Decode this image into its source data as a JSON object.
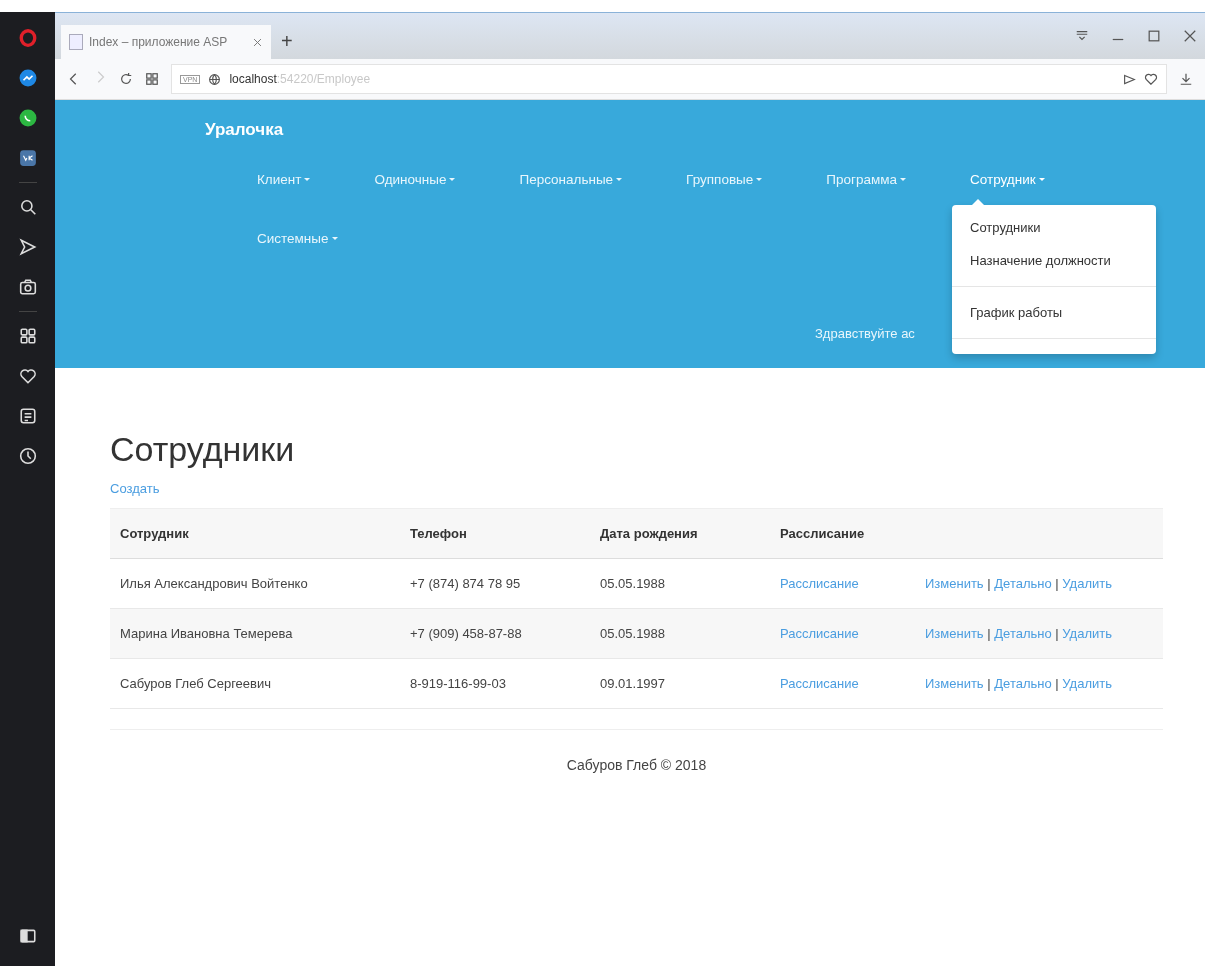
{
  "browser": {
    "tab_title": "Index – приложение ASP",
    "new_tab": "+",
    "vpn_badge": "VPN",
    "url_host": "localhost",
    "url_path": ":54220/Employee"
  },
  "navbar": {
    "brand": "Уралочка",
    "greeting": "Здравствуйте ас",
    "menus": [
      {
        "label": "Клиент",
        "expanded": false
      },
      {
        "label": "Одиночные",
        "expanded": false
      },
      {
        "label": "Персональные",
        "expanded": false
      },
      {
        "label": "Групповые",
        "expanded": false
      },
      {
        "label": "Программа",
        "expanded": false
      },
      {
        "label": "Сотрудник",
        "expanded": true,
        "items": [
          {
            "kind": "item",
            "label": "Сотрудники"
          },
          {
            "kind": "item",
            "label": "Назначение должности"
          },
          {
            "kind": "divider"
          },
          {
            "kind": "item",
            "label": "График работы"
          },
          {
            "kind": "divider"
          }
        ]
      },
      {
        "label": "Системные",
        "expanded": false
      }
    ]
  },
  "page": {
    "title": "Сотрудники",
    "create_link": "Создать",
    "table": {
      "columns": [
        "Сотрудник",
        "Телефон",
        "Дата рождения",
        "Расслисание"
      ],
      "rows": [
        {
          "name": "Илья Александрович Войтенко",
          "phone": "+7 (874) 874 78 95",
          "birth_date": "05.05.1988",
          "schedule_link": "Расслисание",
          "actions": [
            {
              "kind": "link",
              "text": "Изменить"
            },
            {
              "kind": "separator",
              "text": "|"
            },
            {
              "kind": "link",
              "text": "Детально"
            },
            {
              "kind": "separator",
              "text": "|"
            },
            {
              "kind": "link",
              "text": "Удалить"
            }
          ]
        },
        {
          "name": "Марина Ивановна Темерева",
          "phone": "+7 (909) 458-87-88",
          "birth_date": "05.05.1988",
          "schedule_link": "Расслисание",
          "actions": [
            {
              "kind": "link",
              "text": "Изменить"
            },
            {
              "kind": "separator",
              "text": "|"
            },
            {
              "kind": "link",
              "text": "Детально"
            },
            {
              "kind": "separator",
              "text": "|"
            },
            {
              "kind": "link",
              "text": "Удалить"
            }
          ]
        },
        {
          "name": "Сабуров Глеб Сергеевич",
          "phone": "8-919-116-99-03",
          "birth_date": "09.01.1997",
          "schedule_link": "Расслисание",
          "actions": [
            {
              "kind": "link",
              "text": "Изменить"
            },
            {
              "kind": "separator",
              "text": "|"
            },
            {
              "kind": "link",
              "text": "Детально"
            },
            {
              "kind": "separator",
              "text": "|"
            },
            {
              "kind": "link",
              "text": "Удалить"
            }
          ]
        }
      ]
    },
    "footer": "Сабуров Глеб © 2018"
  }
}
